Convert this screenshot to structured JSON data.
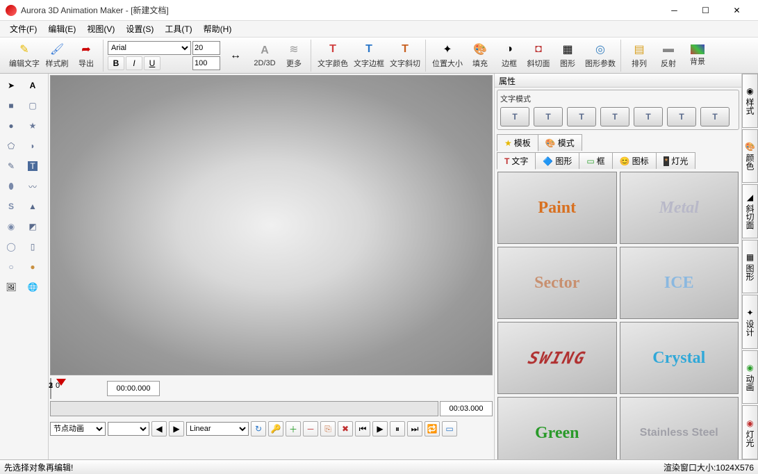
{
  "window": {
    "title": "Aurora 3D Animation Maker - [新建文档]"
  },
  "menu": {
    "file": "文件(F)",
    "edit": "编辑(E)",
    "view": "视图(V)",
    "settings": "设置(S)",
    "tools": "工具(T)",
    "help": "帮助(H)"
  },
  "toolbar": {
    "edit_text": "编辑文字",
    "style_brush": "样式刷",
    "export": "导出",
    "font_name": "Arial",
    "size1": "20",
    "size2": "100",
    "bold": "B",
    "italic": "I",
    "underline": "U",
    "mode_label": "2D/3D",
    "more_label": "更多",
    "text_color": "文字颜色",
    "text_border": "文字边框",
    "text_bevel": "文字斜切",
    "pos_size": "位置大小",
    "fill": "填充",
    "border": "边框",
    "bevel": "斜切面",
    "shape": "图形",
    "shape_params": "图形参数",
    "arrange": "排列",
    "reflect": "反射",
    "background": "背景"
  },
  "properties": {
    "title": "属性",
    "text_mode": "文字模式",
    "tab_template": "模板",
    "tab_mode": "模式",
    "subtab_text": "文字",
    "subtab_shape": "图形",
    "subtab_frame": "框",
    "subtab_icon": "图标",
    "subtab_light": "灯光"
  },
  "thumbs": {
    "paint": "Paint",
    "metal": "Metal",
    "sector": "Sector",
    "ice": "ICE",
    "swing": "SWING",
    "crystal": "Crystal",
    "green": "Green",
    "stainless": "Stainless Steel"
  },
  "sidetabs": {
    "style": "样式",
    "color": "颜色",
    "bevel": "斜切面",
    "shape": "图形",
    "design": "设计",
    "anim": "动画",
    "light": "灯光"
  },
  "timeline": {
    "t0": "0",
    "t1": "1",
    "t2": "2",
    "t3": "3",
    "tc1": "00:00.000",
    "tc2": "00:03.000",
    "type": "节点动画",
    "curve": "Linear"
  },
  "status": {
    "hint": "先选择对象再编辑!",
    "render": "渲染窗口大小:1024X576"
  }
}
